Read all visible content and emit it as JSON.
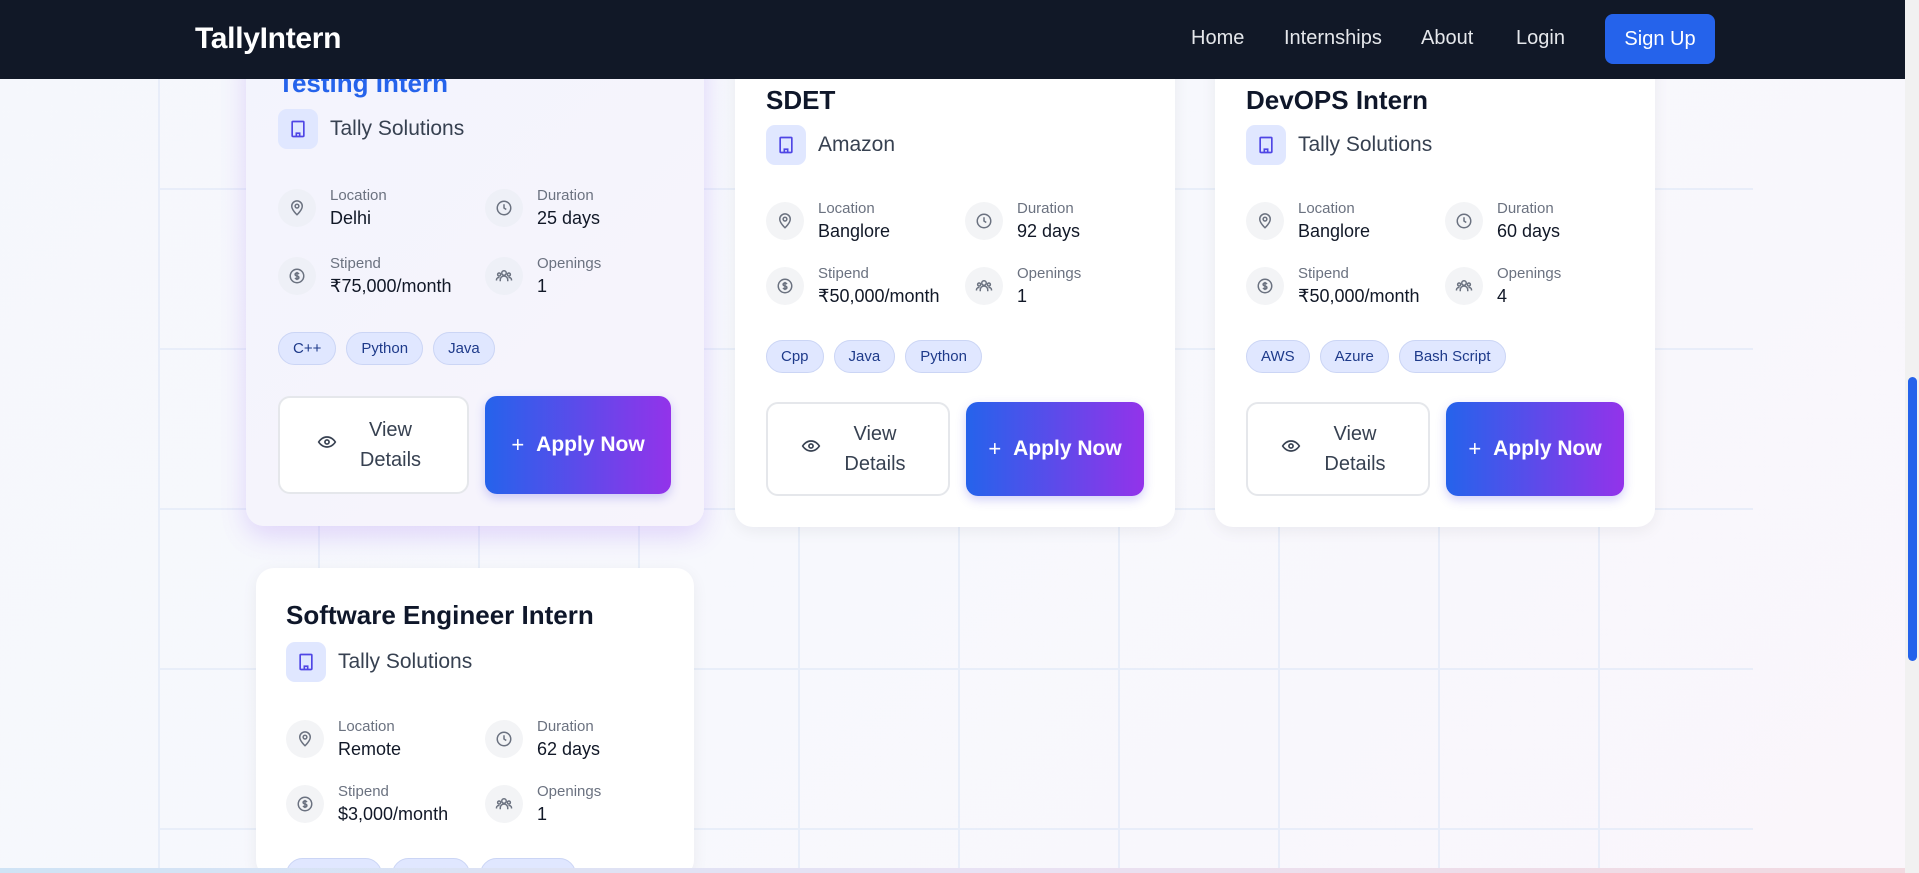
{
  "navbar": {
    "brand": "TallyIntern",
    "links": [
      "Home",
      "Internships",
      "About",
      "Login"
    ],
    "signup": "Sign Up"
  },
  "labels": {
    "location": "Location",
    "duration": "Duration",
    "stipend": "Stipend",
    "openings": "Openings",
    "view_details": "View Details",
    "apply_now": "Apply Now"
  },
  "cards": [
    {
      "title": "Testing Intern",
      "company": "Tally Solutions",
      "location": "Delhi",
      "duration": "25 days",
      "stipend": "₹75,000/month",
      "openings": "1",
      "tags": [
        "C++",
        "Python",
        "Java"
      ]
    },
    {
      "title": "SDET",
      "company": "Amazon",
      "location": "Banglore",
      "duration": "92 days",
      "stipend": "₹50,000/month",
      "openings": "1",
      "tags": [
        "Cpp",
        "Java",
        "Python"
      ]
    },
    {
      "title": "DevOPS Intern",
      "company": "Tally Solutions",
      "location": "Banglore",
      "duration": "60 days",
      "stipend": "₹50,000/month",
      "openings": "4",
      "tags": [
        "AWS",
        "Azure",
        "Bash Script"
      ]
    },
    {
      "title": "Software Engineer Intern",
      "company": "Tally Solutions",
      "location": "Remote",
      "duration": "62 days",
      "stipend": "$3,000/month",
      "openings": "1",
      "tags": [
        "",
        "",
        ""
      ]
    }
  ]
}
